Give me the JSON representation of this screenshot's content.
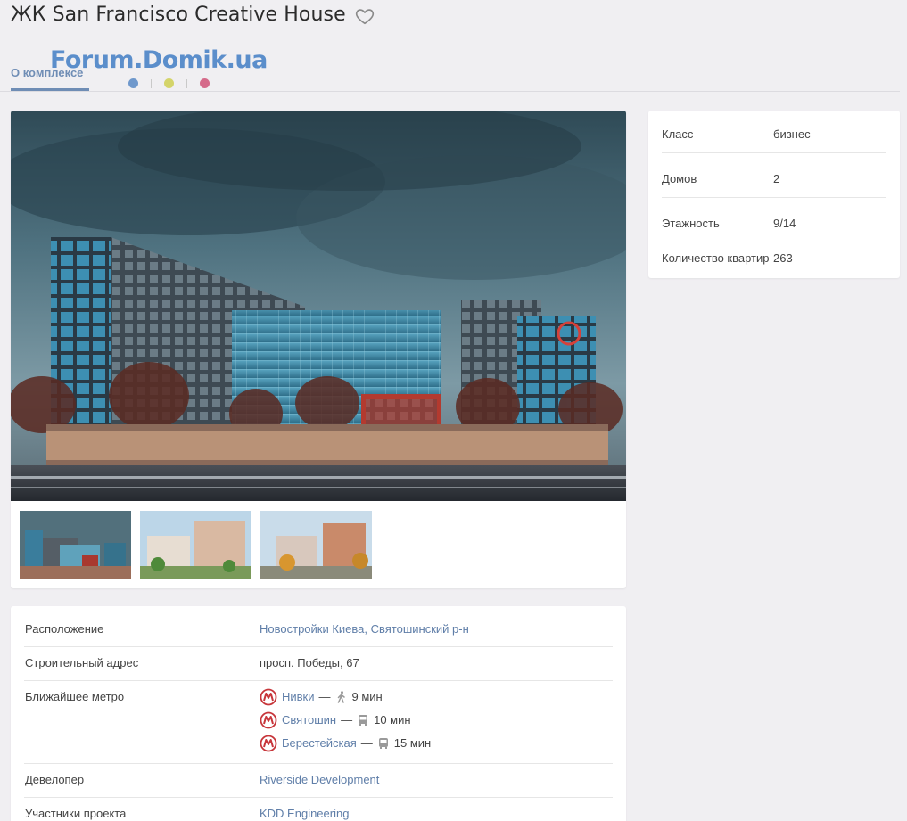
{
  "header": {
    "title": "ЖК San Francisco Creative House",
    "watermark": "Forum.Domik.ua"
  },
  "tabs": [
    {
      "label": "О комплексе",
      "active": true
    }
  ],
  "indicator_dots": [
    "#6f98cc",
    "#d4d46a",
    "#d56a8a"
  ],
  "params": [
    {
      "label": "Класс",
      "value": "бизнес"
    },
    {
      "label": "Домов",
      "value": "2"
    },
    {
      "label": "Этажность",
      "value": "9/14"
    },
    {
      "label": "Количество квартир",
      "value": "263"
    }
  ],
  "info": {
    "location_label": "Расположение",
    "location_value": "Новостройки Киева, Святошинский р-н",
    "address_label": "Строительный адрес",
    "address_value": "просп. Победы, 67",
    "metro_label": "Ближайшее метро",
    "metro": [
      {
        "station": "Нивки",
        "mode": "walk",
        "time": "9 мин"
      },
      {
        "station": "Святошин",
        "mode": "bus",
        "time": "10 мин"
      },
      {
        "station": "Берестейская",
        "mode": "bus",
        "time": "15 мин"
      }
    ],
    "developer_label": "Девелопер",
    "developer_value": "Riverside Development",
    "participants_label": "Участники проекта",
    "participants_value": "KDD Engineering"
  },
  "colors": {
    "accent": "#6f8db5",
    "link": "#5f7ea8",
    "metro_red": "#c7363b",
    "background": "#f0eff2"
  }
}
